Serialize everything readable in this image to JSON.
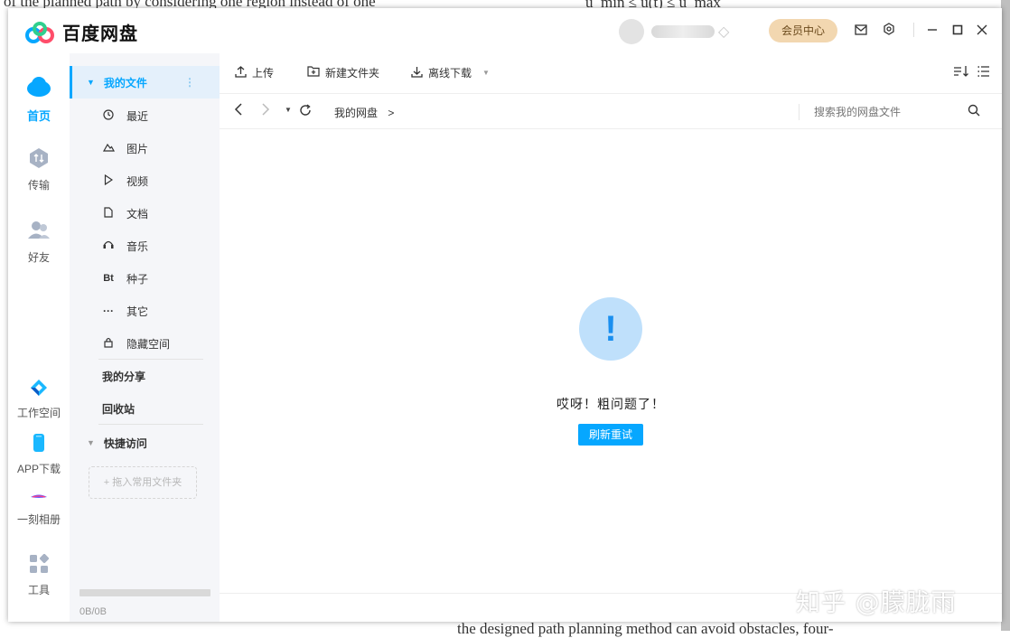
{
  "background_doc": {
    "top_line": "of the planned path by considering one region instead of one",
    "top_right_formula": "u_min ≤ u(t) ≤ u_max",
    "bottom_line": "the designed path planning method can avoid obstacles, four-"
  },
  "app": {
    "name": "百度网盘"
  },
  "header": {
    "vip_label": "会员中心",
    "icons": [
      "mail-icon",
      "settings-icon",
      "minimize-icon",
      "maximize-icon",
      "close-icon"
    ]
  },
  "leftnav": {
    "items": [
      {
        "label": "首页",
        "icon": "cloud-icon",
        "active": true
      },
      {
        "label": "传输",
        "icon": "transfer-icon"
      },
      {
        "label": "好友",
        "icon": "friends-icon"
      },
      {
        "label": "工作空间",
        "icon": "workspace-icon"
      },
      {
        "label": "APP下载",
        "icon": "phone-icon"
      },
      {
        "label": "一刻相册",
        "icon": "album-icon"
      },
      {
        "label": "工具",
        "icon": "tools-icon"
      }
    ]
  },
  "sidebar": {
    "my_files": "我的文件",
    "items": [
      {
        "label": "最近",
        "icon": "clock-icon"
      },
      {
        "label": "图片",
        "icon": "image-icon"
      },
      {
        "label": "视频",
        "icon": "video-icon"
      },
      {
        "label": "文档",
        "icon": "document-icon"
      },
      {
        "label": "音乐",
        "icon": "headphones-icon"
      },
      {
        "label": "种子",
        "icon": "torrent-icon",
        "glyph": "Bt"
      },
      {
        "label": "其它",
        "icon": "more-icon"
      },
      {
        "label": "隐藏空间",
        "icon": "lock-icon"
      }
    ],
    "my_share": "我的分享",
    "recycle": "回收站",
    "quick_access": "快捷访问",
    "drop_hint": "+ 拖入常用文件夹",
    "storage": "0B/0B",
    "accent": "#06a7ff"
  },
  "toolbar": {
    "upload": "上传",
    "new_folder": "新建文件夹",
    "offline_download": "离线下载"
  },
  "path": {
    "root": "我的网盘",
    "separator": ">",
    "search_placeholder": "搜索我的网盘文件"
  },
  "empty_state": {
    "icon": "!",
    "message": "哎呀！粗问题了！",
    "retry": "刷新重试"
  },
  "watermark": "知乎 @朦胧雨"
}
